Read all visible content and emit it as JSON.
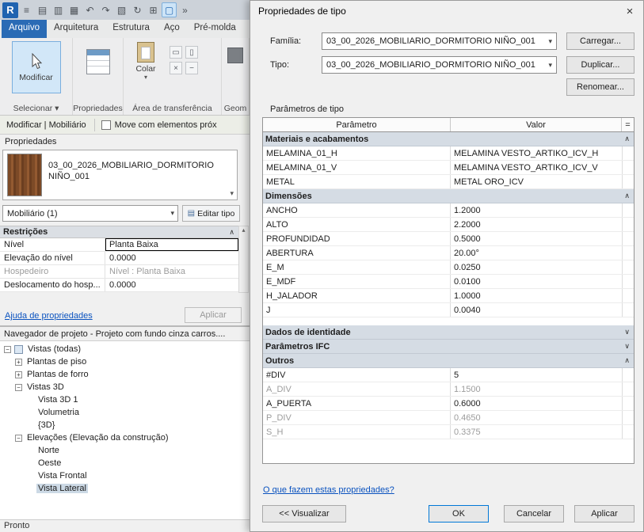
{
  "colors": {
    "accent": "#2a6bb5",
    "selection_fill": "#d2e7f8",
    "group_header": "#d5dce4",
    "link": "#0a52bf"
  },
  "app": {
    "icons": {
      "dropdown": "▾",
      "chevron_up": "∧",
      "chevron_down": "∨",
      "up_arrow": "▴",
      "edit_type": "▤"
    },
    "quick_access": [
      {
        "name": "app-logo",
        "glyph": "R",
        "style": "logo"
      },
      {
        "name": "menu-icon",
        "glyph": "≡"
      },
      {
        "name": "new-icon",
        "glyph": "▤"
      },
      {
        "name": "open-icon",
        "glyph": "▥"
      },
      {
        "name": "save-icon",
        "glyph": "▦"
      },
      {
        "name": "undo-icon",
        "glyph": "↶"
      },
      {
        "name": "redo-icon",
        "glyph": "↷"
      },
      {
        "name": "print-icon",
        "glyph": "▧"
      },
      {
        "name": "sync-icon",
        "glyph": "↻"
      },
      {
        "name": "measure-icon",
        "glyph": "⊞"
      },
      {
        "name": "modify-toggle-icon",
        "glyph": "▢",
        "style": "toggled"
      },
      {
        "name": "overflow-chevron-icon",
        "glyph": "»"
      }
    ],
    "ribbon_tabs": [
      {
        "label": "Arquivo",
        "active": true
      },
      {
        "label": "Arquitetura"
      },
      {
        "label": "Estrutura"
      },
      {
        "label": "Aço"
      },
      {
        "label": "Pré-molda"
      }
    ],
    "ribbon": {
      "modify_label": "Modificar",
      "select_panel_label": "Selecionar ▾",
      "properties_panel_label": "Propriedades",
      "paste_label": "Colar",
      "clipboard_panel_label": "Área de transferência",
      "geometry_panel_label": "Geom",
      "small_icons": [
        {
          "name": "cut-icon",
          "glyph": "▭"
        },
        {
          "name": "copy-icon",
          "glyph": "▯"
        },
        {
          "name": "delete-icon",
          "glyph": "×"
        },
        {
          "name": "match-icon",
          "glyph": "−"
        }
      ]
    },
    "context_bar": {
      "title": "Modificar | Mobiliário",
      "checkbox_label": "Move com elementos próx"
    },
    "properties_palette": {
      "title": "Propriedades",
      "family_line1": "03_00_2026_MOBILIARIO_DORMITORIO",
      "family_line2": "NIÑO_001",
      "type_selector": "Mobiliário (1)",
      "edit_type_button": "Editar tipo",
      "section": "Restrições",
      "rows": [
        {
          "param": "Nível",
          "value": "Planta Baixa",
          "focused": true
        },
        {
          "param": "Elevação do nível",
          "value": "0.0000"
        },
        {
          "param": "Hospedeiro",
          "value": "Nível : Planta Baixa",
          "disabled": true
        },
        {
          "param": "Deslocamento do hosp...",
          "value": "0.0000"
        }
      ],
      "help_link": "Ajuda de propriedades",
      "apply_button": "Aplicar"
    },
    "project_browser": {
      "title": "Navegador de projeto - Projeto com fundo cinza carros....",
      "items": [
        {
          "label": "Vistas (todas)",
          "depth": 0,
          "expander": "-",
          "icon": true
        },
        {
          "label": "Plantas de piso",
          "depth": 1,
          "expander": "+"
        },
        {
          "label": "Plantas de forro",
          "depth": 1,
          "expander": "+"
        },
        {
          "label": "Vistas 3D",
          "depth": 1,
          "expander": "-"
        },
        {
          "label": "Vista 3D 1",
          "depth": 2
        },
        {
          "label": "Volumetria",
          "depth": 2
        },
        {
          "label": "{3D}",
          "depth": 2
        },
        {
          "label": "Elevações (Elevação da construção)",
          "depth": 1,
          "expander": "-"
        },
        {
          "label": "Norte",
          "depth": 2
        },
        {
          "label": "Oeste",
          "depth": 2
        },
        {
          "label": "Vista Frontal",
          "depth": 2
        },
        {
          "label": "Vista Lateral",
          "depth": 2,
          "selected": true
        }
      ]
    },
    "status_bar": {
      "ready": "Pronto"
    }
  },
  "dialog": {
    "title": "Propriedades de tipo",
    "close_icon": "×",
    "familia_label": "Família:",
    "familia_value": "03_00_2026_MOBILIARIO_DORMITORIO NIÑO_001",
    "tipo_label": "Tipo:",
    "tipo_value": "03_00_2026_MOBILIARIO_DORMITORIO NIÑO_001",
    "load_button": "Carregar...",
    "duplicate_button": "Duplicar...",
    "rename_button": "Renomear...",
    "table_caption": "Parâmetros de tipo",
    "columns": {
      "param": "Parâmetro",
      "value": "Valor",
      "eq": "="
    },
    "groups": [
      {
        "name": "Materiais e acabamentos",
        "state": "expanded",
        "rows": [
          {
            "param": "MELAMINA_01_H",
            "value": "MELAMINA VESTO_ARTIKO_ICV_H"
          },
          {
            "param": "MELAMINA_01_V",
            "value": "MELAMINA VESTO_ARTIKO_ICV_V"
          },
          {
            "param": "METAL",
            "value": "METAL ORO_ICV"
          }
        ]
      },
      {
        "name": "Dimensões",
        "state": "expanded",
        "gap_after": true,
        "rows": [
          {
            "param": "ANCHO",
            "value": "1.2000"
          },
          {
            "param": "ALTO",
            "value": "2.2000"
          },
          {
            "param": "PROFUNDIDAD",
            "value": "0.5000"
          },
          {
            "param": "ABERTURA",
            "value": "20.00°"
          },
          {
            "param": "E_M",
            "value": "0.0250"
          },
          {
            "param": "E_MDF",
            "value": "0.0100"
          },
          {
            "param": "H_JALADOR",
            "value": "1.0000"
          },
          {
            "param": "J",
            "value": "0.0040"
          }
        ]
      },
      {
        "name": "Dados de identidade",
        "state": "collapsed",
        "rows": []
      },
      {
        "name": "Parâmetros IFC",
        "state": "collapsed",
        "rows": []
      },
      {
        "name": "Outros",
        "state": "expanded",
        "rows": [
          {
            "param": "#DIV",
            "value": "5"
          },
          {
            "param": "A_DIV",
            "value": "1.1500",
            "disabled": true
          },
          {
            "param": "A_PUERTA",
            "value": "0.6000"
          },
          {
            "param": "P_DIV",
            "value": "0.4650",
            "disabled": true
          },
          {
            "param": "S_H",
            "value": "0.3375",
            "disabled": true
          }
        ]
      }
    ],
    "link": "O que fazem estas propriedades?",
    "buttons": {
      "preview": "<< Visualizar",
      "ok": "OK",
      "cancel": "Cancelar",
      "apply": "Aplicar"
    }
  }
}
